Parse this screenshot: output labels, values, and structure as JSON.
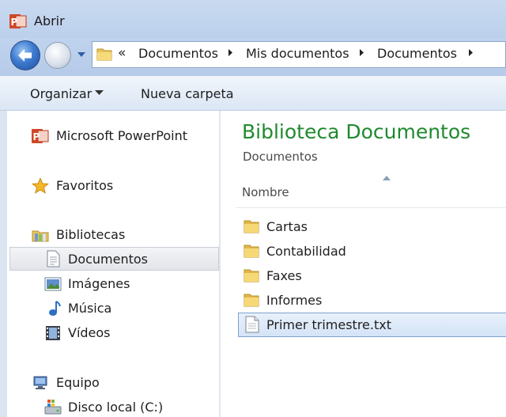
{
  "window": {
    "title": "Abrir"
  },
  "address": {
    "overflow_chevron": "«",
    "crumbs": [
      "Documentos",
      "Mis documentos",
      "Documentos"
    ]
  },
  "toolbar": {
    "organize_label": "Organizar",
    "new_folder_label": "Nueva carpeta"
  },
  "nav": {
    "app_label": "Microsoft PowerPoint",
    "favorites_label": "Favoritos",
    "libraries_label": "Bibliotecas",
    "libraries": [
      "Documentos",
      "Imágenes",
      "Música",
      "Vídeos"
    ],
    "computer_label": "Equipo",
    "drives": [
      "Disco local (C:)"
    ]
  },
  "content": {
    "library_title": "Biblioteca Documentos",
    "library_subtitle": "Documentos",
    "column_name": "Nombre",
    "items": [
      {
        "name": "Cartas",
        "type": "folder"
      },
      {
        "name": "Contabilidad",
        "type": "folder"
      },
      {
        "name": "Faxes",
        "type": "folder"
      },
      {
        "name": "Informes",
        "type": "folder"
      },
      {
        "name": "Primer trimestre.txt",
        "type": "txt",
        "selected": true
      }
    ]
  },
  "colors": {
    "library_title": "#1f8a2e",
    "selection_border": "#7da2ce",
    "powerpoint": "#d24726"
  }
}
